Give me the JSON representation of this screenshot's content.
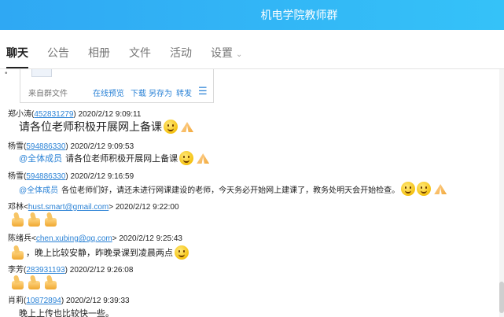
{
  "window": {
    "title": "机电学院教师群"
  },
  "tabs": [
    {
      "label": "聊天"
    },
    {
      "label": "公告"
    },
    {
      "label": "相册"
    },
    {
      "label": "文件"
    },
    {
      "label": "活动"
    },
    {
      "label": "设置"
    }
  ],
  "file_card": {
    "source": "来自群文件",
    "actions": [
      "在线预览",
      "下载",
      "另存为",
      "转发"
    ]
  },
  "messages": [
    {
      "sender": "郑小涛",
      "id": "452831279",
      "time": "2020/2/12 9:09:11",
      "text": "请各位老师积极开展网上备课",
      "emoji": [
        "smiley-icon",
        "pray-icon"
      ]
    },
    {
      "sender": "杨雪",
      "id": "594886330",
      "time": "2020/2/12 9:09:53",
      "mention": "@全体成员",
      "text": "请各位老师积极开展网上备课",
      "emoji": [
        "smiley-icon",
        "pray-icon"
      ]
    },
    {
      "sender": "杨雪",
      "id": "594886330",
      "time": "2020/2/12 9:16:59",
      "mention": "@全体成员",
      "text": "各位老师们好，请还未进行网课建设的老师，今天务必开始网上建课了，教务处明天会开始检查。",
      "emoji": [
        "smiley-icon",
        "smiley-icon",
        "pray-icon"
      ]
    },
    {
      "sender": "邓林",
      "email": "hust.smart@gmail.com",
      "time": "2020/2/12 9:22:00",
      "emoji": [
        "thumbs-up-icon",
        "thumbs-up-icon",
        "thumbs-up-icon"
      ]
    },
    {
      "sender": "陈绪兵",
      "email": "chen.xubing@qq.com",
      "time": "2020/2/12 9:25:43",
      "text": "，晚上比较安静，昨晚录课到凌晨两点",
      "emoji": [
        "thumbs-up-icon",
        "smiley-icon"
      ]
    },
    {
      "sender": "李芳",
      "id": "283931193",
      "time": "2020/2/12 9:26:08",
      "emoji": [
        "thumbs-up-icon",
        "thumbs-up-icon",
        "thumbs-up-icon"
      ]
    },
    {
      "sender": "肖莉",
      "id": "10872894",
      "time": "2020/2/12 9:39:33",
      "text": "晚上上传也比较快一些。"
    }
  ]
}
